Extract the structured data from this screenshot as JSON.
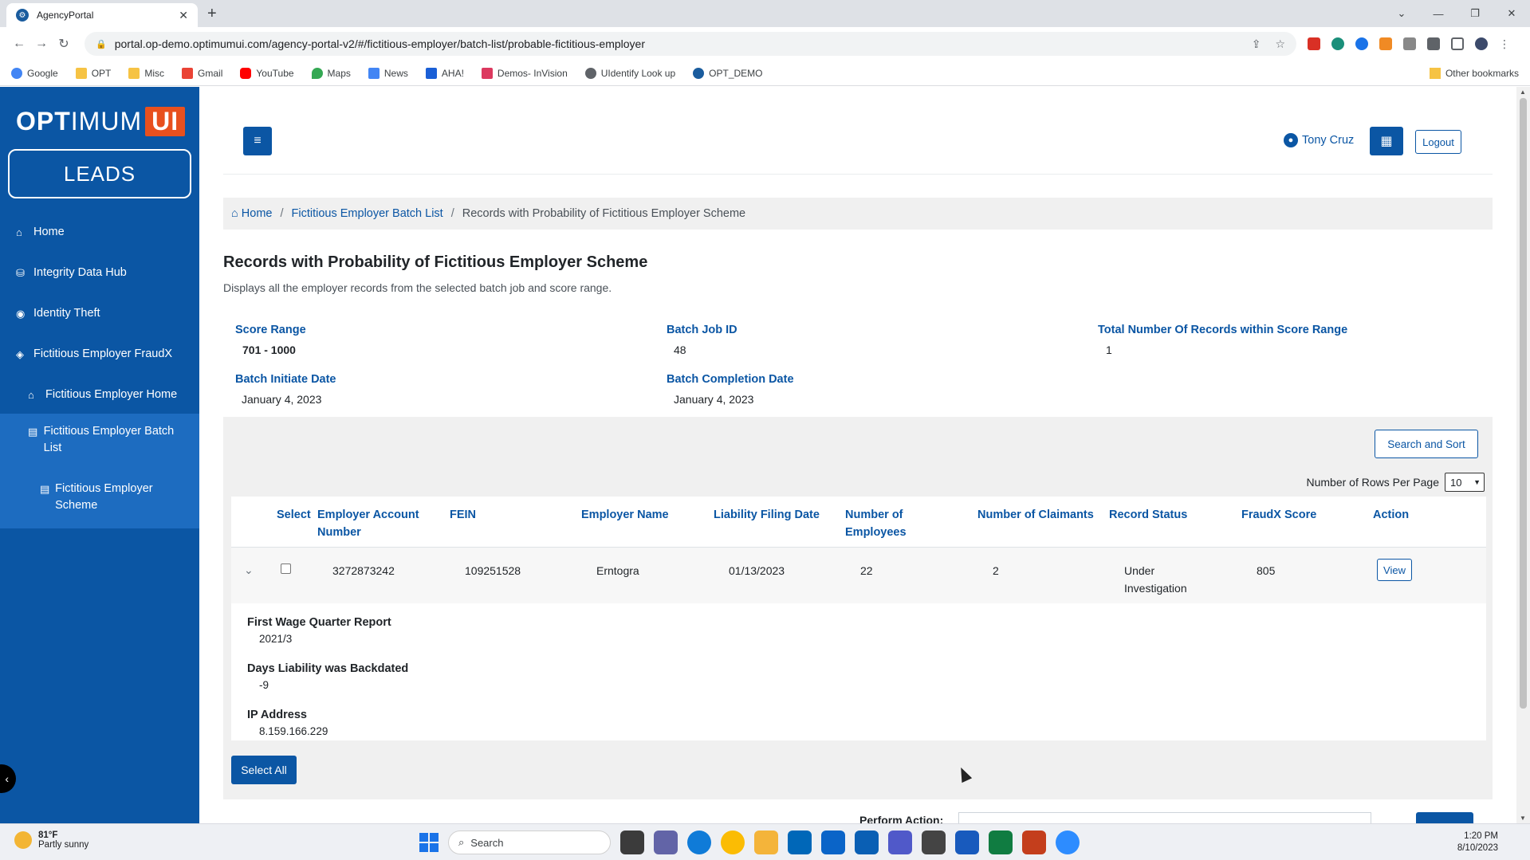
{
  "browser": {
    "tab_title": "AgencyPortal",
    "url": "portal.op-demo.optimumui.com/agency-portal-v2/#/fictitious-employer/batch-list/probable-fictitious-employer",
    "bookmarks": [
      "Google",
      "OPT",
      "Misc",
      "Gmail",
      "YouTube",
      "Maps",
      "News",
      "AHA!",
      "Demos- InVision",
      "UIdentify Look up",
      "OPT_DEMO"
    ],
    "other_bookmarks": "Other bookmarks"
  },
  "sidebar": {
    "logo": {
      "part1": "OPT",
      "part2": "IMUM",
      "part3": "UI"
    },
    "app_name": "LEADS",
    "items": [
      {
        "label": "Home",
        "icon": "home-icon"
      },
      {
        "label": "Integrity Data Hub",
        "icon": "database-icon"
      },
      {
        "label": "Identity Theft",
        "icon": "eye-icon"
      },
      {
        "label": "Fictitious Employer FraudX",
        "icon": "tags-icon"
      },
      {
        "label": "Fictitious Employer Home",
        "icon": "home-icon"
      },
      {
        "label": "Fictitious Employer Batch List",
        "icon": "clipboard-icon"
      },
      {
        "label": "Fictitious Employer Scheme",
        "icon": "clipboard-icon"
      }
    ]
  },
  "header": {
    "user_name": "Tony Cruz",
    "logout_label": "Logout"
  },
  "breadcrumb": {
    "home": "Home",
    "batch_list": "Fictitious Employer Batch List",
    "current": "Records with Probability of Fictitious Employer Scheme"
  },
  "page": {
    "title": "Records with Probability of Fictitious Employer Scheme",
    "description": "Displays all the employer records from the selected batch job and score range."
  },
  "summary": {
    "score_range_label": "Score Range",
    "score_range_value": "701 - 1000",
    "batch_job_id_label": "Batch Job ID",
    "batch_job_id_value": "48",
    "total_records_label": "Total Number Of Records within Score Range",
    "total_records_value": "1",
    "initiate_date_label": "Batch Initiate Date",
    "initiate_date_value": "January 4, 2023",
    "completion_date_label": "Batch Completion Date",
    "completion_date_value": "January 4, 2023"
  },
  "controls": {
    "search_sort_label": "Search and Sort",
    "rows_per_page_label": "Number of Rows Per Page",
    "rows_per_page_value": "10",
    "select_all_label": "Select All",
    "perform_action_label": "Perform Action:"
  },
  "table": {
    "headers": {
      "select": "Select",
      "account_line1": "Employer Account",
      "account_line2": "Number",
      "fein": "FEIN",
      "name": "Employer Name",
      "filing_date": "Liability Filing Date",
      "employees_line1": "Number of",
      "employees_line2": "Employees",
      "claimants": "Number of Claimants",
      "status": "Record Status",
      "score": "FraudX Score",
      "action": "Action"
    },
    "rows": [
      {
        "account": "3272873242",
        "fein": "109251528",
        "name": "Erntogra",
        "filing_date": "01/13/2023",
        "employees": "22",
        "claimants": "2",
        "status_line1": "Under",
        "status_line2": "Investigation",
        "score": "805",
        "action_label": "View",
        "details": {
          "wage_label": "First Wage Quarter Report",
          "wage_value": "2021/3",
          "backdated_label": "Days Liability was Backdated",
          "backdated_value": "-9",
          "ip_label": "IP Address",
          "ip_value": "8.159.166.229"
        }
      }
    ]
  },
  "taskbar": {
    "weather_temp": "81°F",
    "weather_desc": "Partly sunny",
    "search_placeholder": "Search",
    "time": "1:20 PM",
    "date": "8/10/2023"
  },
  "colors": {
    "primary": "#0b56a4",
    "sidebar_active": "#1d6cc0",
    "logo_accent": "#e8501e"
  }
}
